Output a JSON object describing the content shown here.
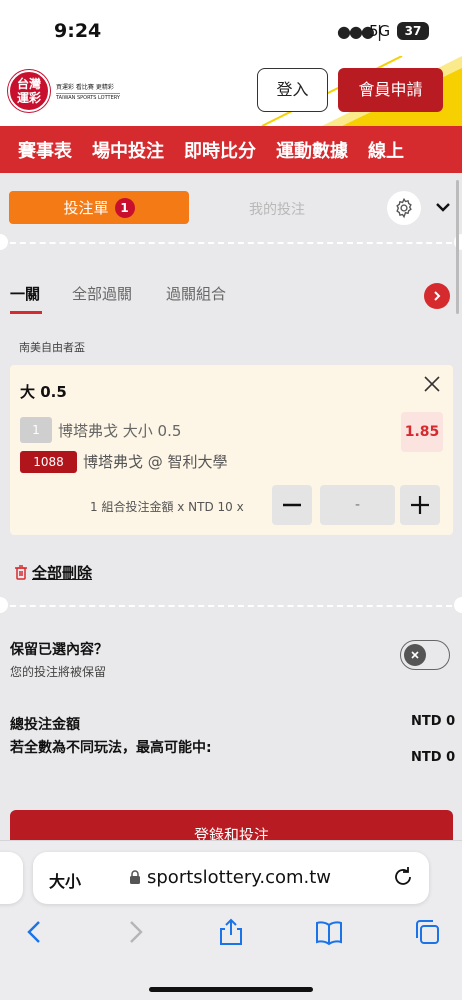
{
  "status_bar": {
    "time": "9:24",
    "signal": "●●●❘",
    "network": "5G",
    "battery": "37"
  },
  "header": {
    "logo_line1": "台灣",
    "logo_line2": "運彩",
    "logo_caption_zh": "買運彩 看比賽 更精彩",
    "logo_caption_en": "TAIWAN SPORTS LOTTERY",
    "login_label": "登入",
    "register_label": "會員申請"
  },
  "nav": {
    "items": [
      "賽事表",
      "場中投注",
      "即時比分",
      "運動數據",
      "線上"
    ]
  },
  "betslip": {
    "tab_slip_label": "投注單",
    "tab_slip_count": "1",
    "tab_mybets_label": "我的投注",
    "subtabs": [
      "一關",
      "全部過關",
      "過關組合"
    ],
    "league": "南美自由者盃",
    "bet": {
      "title": "大 0.5",
      "selection_number": "1",
      "selection_name": "博塔弗戈 大小 0.5",
      "odds": "1.85",
      "match_code": "1088",
      "match_name": "博塔弗戈 @ 智利大學",
      "stake_label": "1 組合投注金額 x NTD 10 x",
      "stake_value": "-"
    },
    "delete_all_label": "全部刪除",
    "retain_title": "保留已選內容？",
    "retain_subtitle": "您的投注將被保留",
    "retain_enabled": false,
    "total_label": "總投注金額",
    "total_value": "NTD 0",
    "maxwin_label": "若全數為不同玩法，最高可能中:",
    "maxwin_value": "NTD 0",
    "submit_label": "登錄和投注"
  },
  "browser": {
    "text_size_label": "大小",
    "domain": "sportslottery.com.tw"
  },
  "colors": {
    "brand_red": "#d52b2f",
    "dark_red": "#b81c22",
    "orange": "#f47a16",
    "card_bg": "#fdf5e6"
  }
}
